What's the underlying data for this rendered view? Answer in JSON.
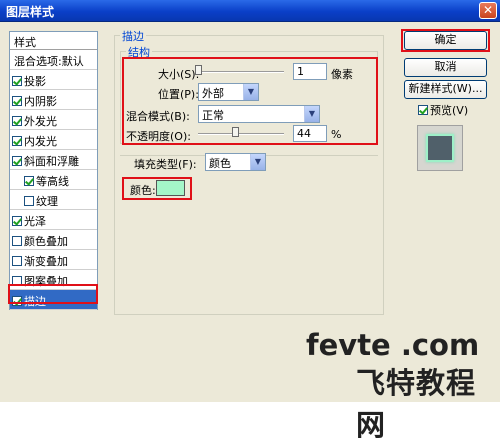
{
  "window": {
    "title": "图层样式"
  },
  "sidebar": {
    "header": "样式",
    "items": [
      {
        "label": "混合选项:默认",
        "checkbox": false,
        "checked": false,
        "indent": false
      },
      {
        "label": "投影",
        "checkbox": true,
        "checked": true,
        "indent": false
      },
      {
        "label": "内阴影",
        "checkbox": true,
        "checked": true,
        "indent": false
      },
      {
        "label": "外发光",
        "checkbox": true,
        "checked": true,
        "indent": false
      },
      {
        "label": "内发光",
        "checkbox": true,
        "checked": true,
        "indent": false
      },
      {
        "label": "斜面和浮雕",
        "checkbox": true,
        "checked": true,
        "indent": false
      },
      {
        "label": "等高线",
        "checkbox": true,
        "checked": true,
        "indent": true
      },
      {
        "label": "纹理",
        "checkbox": true,
        "checked": false,
        "indent": true
      },
      {
        "label": "光泽",
        "checkbox": true,
        "checked": true,
        "indent": false
      },
      {
        "label": "颜色叠加",
        "checkbox": true,
        "checked": false,
        "indent": false
      },
      {
        "label": "渐变叠加",
        "checkbox": true,
        "checked": false,
        "indent": false
      },
      {
        "label": "图案叠加",
        "checkbox": true,
        "checked": false,
        "indent": false
      },
      {
        "label": "描边",
        "checkbox": true,
        "checked": true,
        "indent": false,
        "selected": true
      }
    ]
  },
  "stroke": {
    "group_title": "描边",
    "structure_title": "结构",
    "size_label": "大小(S):",
    "size_value": "1",
    "size_slider_fraction": 0.01,
    "size_unit": "像素",
    "position_label": "位置(P):",
    "position_value": "外部",
    "blend_label": "混合模式(B):",
    "blend_value": "正常",
    "opacity_label": "不透明度(O):",
    "opacity_value": "44",
    "opacity_slider_fraction": 0.44,
    "opacity_unit": "%",
    "fill_type_label": "填充类型(F):",
    "fill_type_value": "颜色",
    "color_label": "颜色:",
    "color_swatch": "#a4f5c8"
  },
  "buttons": {
    "ok": "确定",
    "cancel": "取消",
    "new_style": "新建样式(W)...",
    "preview_label": "预览(V)"
  },
  "colors": {
    "highlight": "#e01018",
    "selection": "#316ac5",
    "group_title": "#0046d5"
  },
  "watermark": {
    "line1": "fevte .com",
    "line2": "飞特教程网"
  }
}
